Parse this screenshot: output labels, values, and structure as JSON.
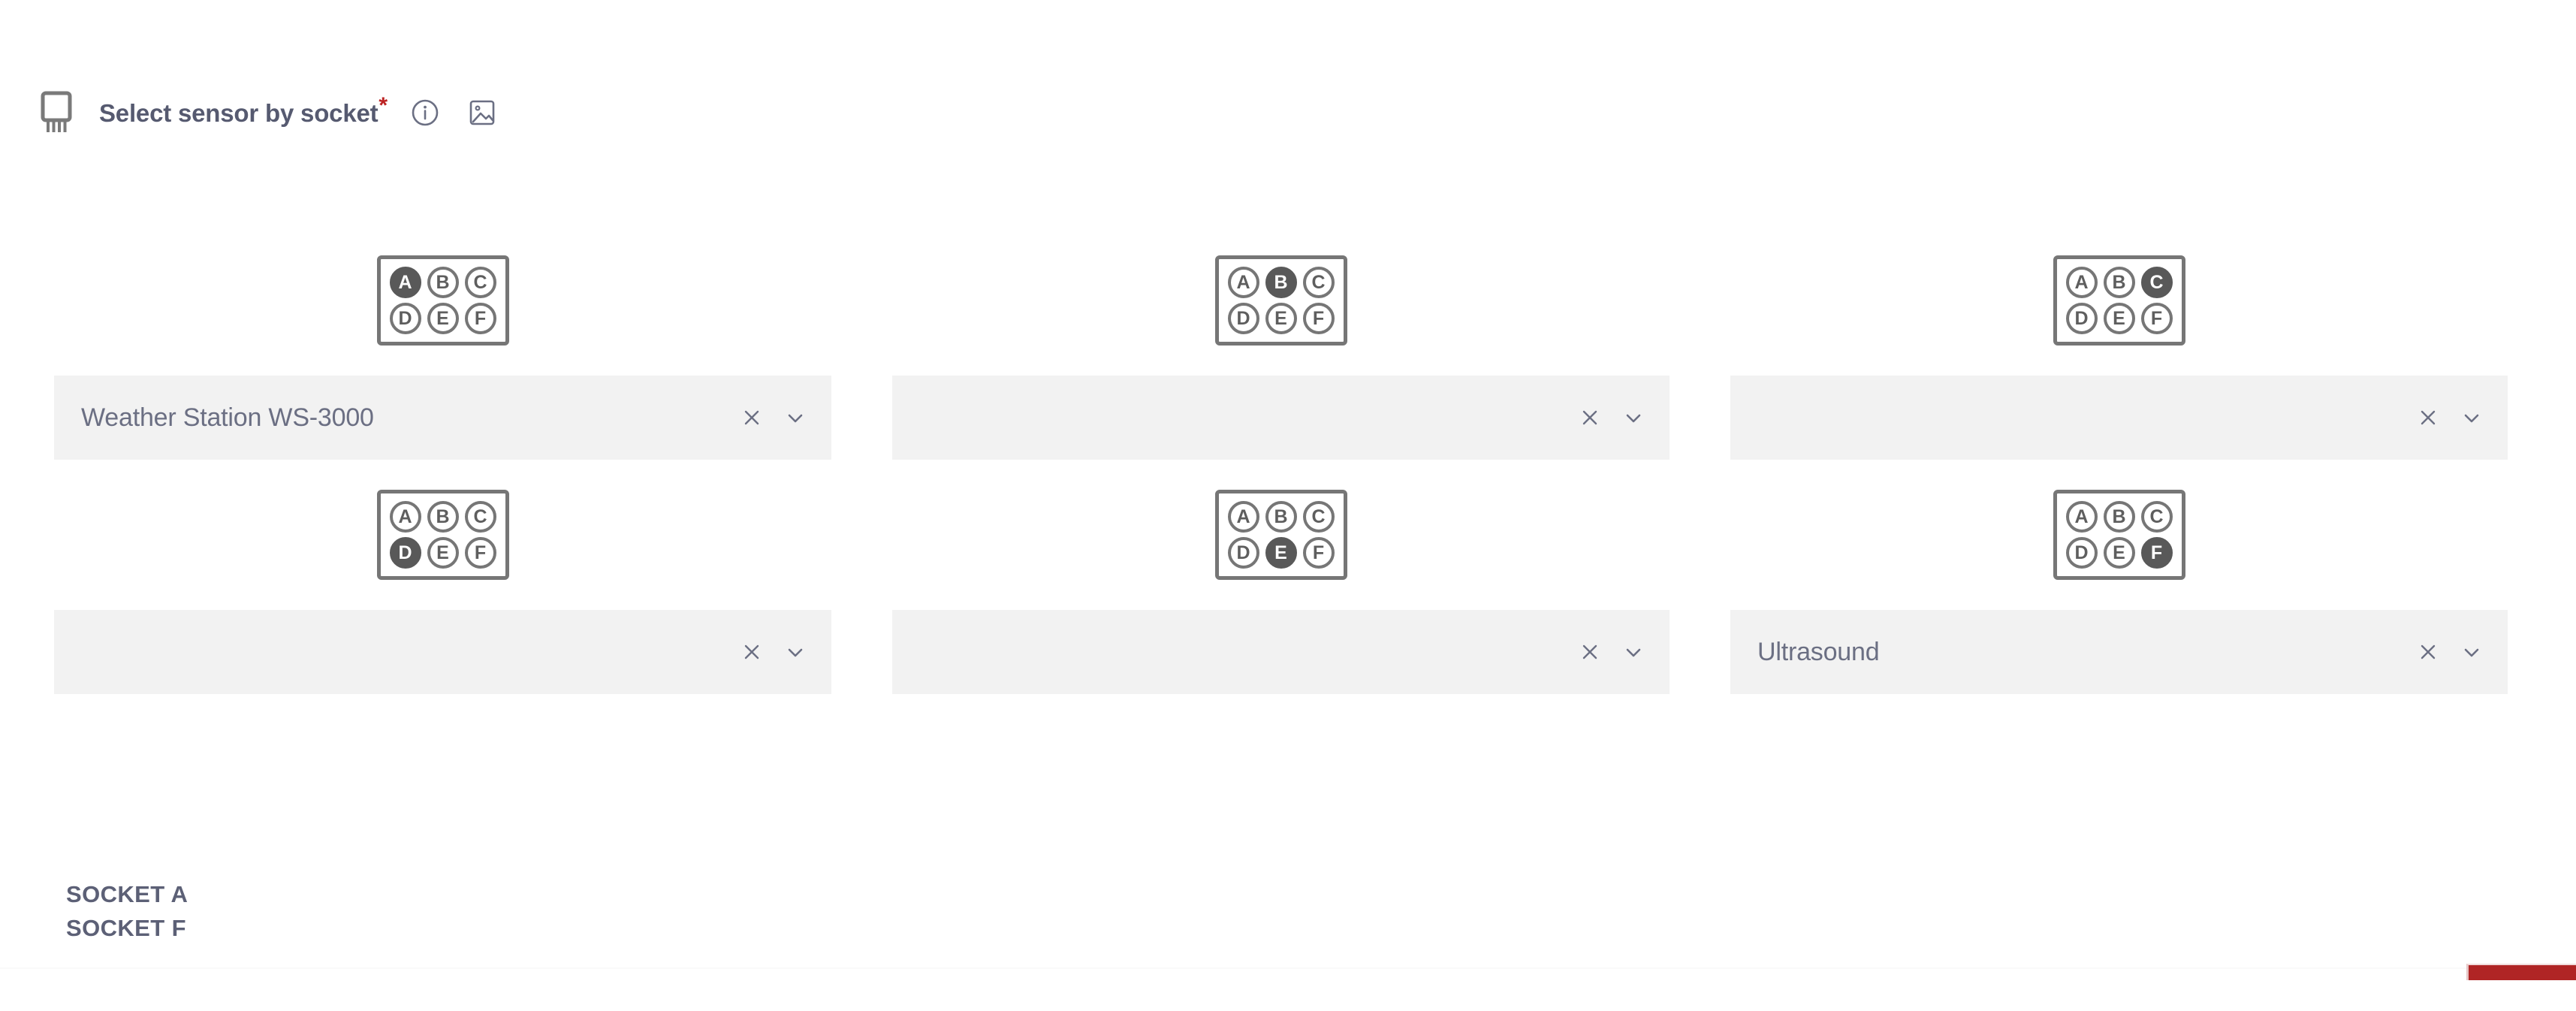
{
  "header": {
    "chip_icon": "sensor-chip-icon",
    "label": "Select sensor by socket",
    "required_marker": "*",
    "info_icon": "info-circle-icon",
    "image_icon": "image-preview-icon"
  },
  "colors": {
    "accent_red": "#b02525",
    "required_star": "#bc2222",
    "field_background": "#f2f2f2",
    "text": "#565a70",
    "pin_border": "#767676",
    "pin_active_fill": "#595959"
  },
  "socket_letters": [
    "A",
    "B",
    "C",
    "D",
    "E",
    "F"
  ],
  "cells": [
    {
      "socket": "A",
      "active_pin": "A",
      "value": "Weather Station WS-3000",
      "placeholder": "",
      "clear_icon": "clear-x-icon",
      "chevron_icon": "chevron-down-icon"
    },
    {
      "socket": "B",
      "active_pin": "B",
      "value": "",
      "placeholder": "",
      "clear_icon": "clear-x-icon",
      "chevron_icon": "chevron-down-icon"
    },
    {
      "socket": "C",
      "active_pin": "C",
      "value": "",
      "placeholder": "",
      "clear_icon": "clear-x-icon",
      "chevron_icon": "chevron-down-icon"
    },
    {
      "socket": "D",
      "active_pin": "D",
      "value": "",
      "placeholder": "",
      "clear_icon": "clear-x-icon",
      "chevron_icon": "chevron-down-icon"
    },
    {
      "socket": "E",
      "active_pin": "E",
      "value": "",
      "placeholder": "",
      "clear_icon": "clear-x-icon",
      "chevron_icon": "chevron-down-icon"
    },
    {
      "socket": "F",
      "active_pin": "F",
      "value": "Ultrasound",
      "placeholder": "",
      "clear_icon": "clear-x-icon",
      "chevron_icon": "chevron-down-icon"
    }
  ],
  "socket_list": [
    {
      "label": "SOCKET A"
    },
    {
      "label": "SOCKET F"
    }
  ]
}
